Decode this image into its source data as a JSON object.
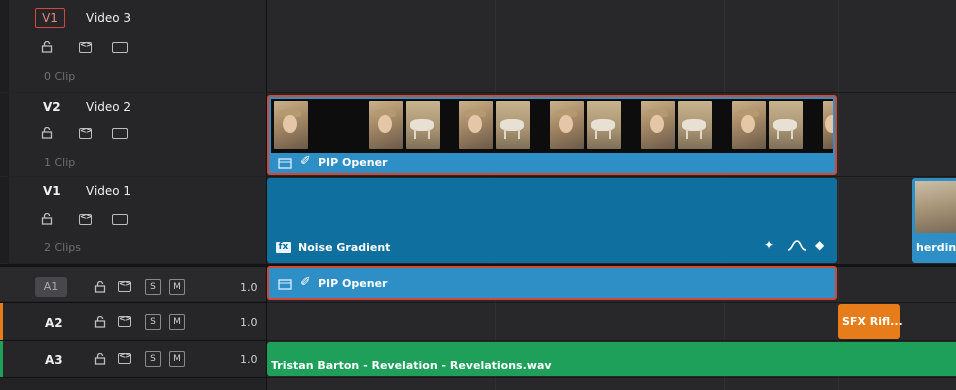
{
  "tracks": {
    "video": [
      {
        "id": "V1",
        "name": "Video 3",
        "clips": "0 Clip"
      },
      {
        "id": "V2",
        "name": "Video 2",
        "clips": "1 Clip"
      },
      {
        "id": "V1",
        "name": "Video 1",
        "clips": "2 Clips"
      }
    ],
    "audio": [
      {
        "id": "A1",
        "volume": "1.0",
        "s_label": "S",
        "m_label": "M"
      },
      {
        "id": "A2",
        "volume": "1.0",
        "s_label": "S",
        "m_label": "M"
      },
      {
        "id": "A3",
        "volume": "1.0",
        "s_label": "S",
        "m_label": "M"
      }
    ]
  },
  "clips": {
    "pip_video": {
      "label": "PIP Opener"
    },
    "noise_gradient": {
      "label": "Noise Gradient"
    },
    "herding": {
      "label": "herding"
    },
    "pip_audio": {
      "label": "PIP Opener"
    },
    "sfx": {
      "label": "SFX Rifl..."
    },
    "music": {
      "label": "Tristan Barton - Revelation - Revelations.wav"
    }
  },
  "colors": {
    "video_clip": "#0f6f9e",
    "audio_clip": "#2e8fc6",
    "music_clip": "#1ea05a",
    "sfx_clip": "#e67d1a",
    "selection": "#d14a37"
  },
  "icons": [
    "lock-icon",
    "link-icon",
    "film-icon",
    "fx-icon",
    "chain-icon",
    "sparkle-icon",
    "curve-icon",
    "keyframe-icon"
  ]
}
